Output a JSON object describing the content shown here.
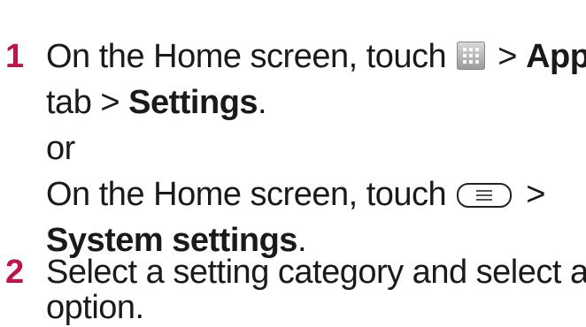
{
  "steps": [
    {
      "number": "1",
      "line1_a": "On the Home screen, touch",
      "line1_b": " > ",
      "line1_apps": "Apps",
      "line2_tab": "tab > ",
      "line2_settings": "Settings",
      "line2_end": ".",
      "or": "or",
      "line4_a": "On the Home screen, touch",
      "line4_b": " >",
      "line5_system": "System settings",
      "line5_end": "."
    },
    {
      "number": "2",
      "line1": "Select a setting category and select an",
      "line2": "option."
    }
  ],
  "icons": {
    "apps": "apps-grid-icon",
    "menu": "menu-key-icon"
  },
  "colors": {
    "step_number": "#c0144b",
    "text": "#1a1a1a"
  }
}
